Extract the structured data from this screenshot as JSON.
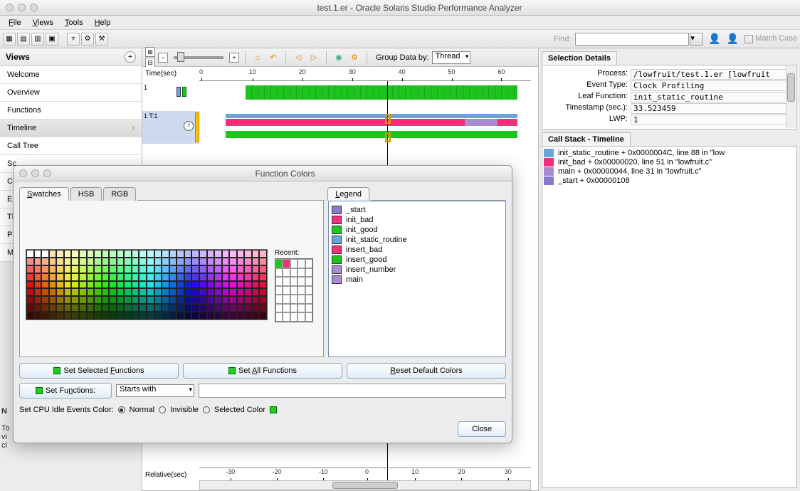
{
  "window": {
    "title": "test.1.er  -  Oracle Solaris Studio Performance Analyzer"
  },
  "menubar": {
    "file": "File",
    "views": "Views",
    "tools": "Tools",
    "help": "Help"
  },
  "toolbar": {
    "find_label": "Find:",
    "match_case": "Match Case"
  },
  "sidebar": {
    "title": "Views",
    "items": [
      {
        "label": "Welcome"
      },
      {
        "label": "Overview"
      },
      {
        "label": "Functions"
      },
      {
        "label": "Timeline",
        "selected": true
      },
      {
        "label": "Call Tree"
      },
      {
        "label": "Sc"
      },
      {
        "label": "Ca"
      },
      {
        "label": "Ex"
      },
      {
        "label": "Th"
      },
      {
        "label": "Pr"
      },
      {
        "label": "M"
      }
    ]
  },
  "timeline_toolbar": {
    "group_by_label": "Group Data by:",
    "group_by_value": "Thread"
  },
  "timeline": {
    "axis_label": "Time(sec)",
    "ticks": [
      "0",
      "10",
      "20",
      "30",
      "40",
      "50",
      "60"
    ],
    "row1_label": "1",
    "row2_label": "1 T:1",
    "bottom_label": "Relative(sec)",
    "bottom_ticks": [
      "-30",
      "-20",
      "-10",
      "0",
      "10",
      "20",
      "30"
    ]
  },
  "selection_details": {
    "title": "Selection Details",
    "process_label": "Process:",
    "process_value": "/lowfruit/test.1.er [lowfruit",
    "event_label": "Event Type:",
    "event_value": "Clock Profiling",
    "leaf_label": "Leaf Function:",
    "leaf_value": "init_static_routine",
    "ts_label": "Timestamp (sec.):",
    "ts_value": "33.523459",
    "lwp_label": "LWP:",
    "lwp_value": "1"
  },
  "callstack": {
    "title": "Call Stack - Timeline",
    "rows": [
      {
        "color": "#6aa5d8",
        "text": "init_static_routine + 0x0000004C, line 88 in \"low"
      },
      {
        "color": "#f03078",
        "text": "init_bad + 0x00000020, line 51 in \"lowfruit.c\""
      },
      {
        "color": "#a88bd0",
        "text": "main + 0x00000044, line 31 in \"lowfruit.c\""
      },
      {
        "color": "#8a78c8",
        "text": "_start + 0x00000108"
      }
    ]
  },
  "dialog": {
    "title": "Function Colors",
    "tab_swatches": "Swatches",
    "tab_hsb": "HSB",
    "tab_rgb": "RGB",
    "recent_label": "Recent:",
    "legend_tab": "Legend",
    "legend": [
      {
        "color": "#8a78c8",
        "label": "_start"
      },
      {
        "color": "#f03078",
        "label": "init_bad"
      },
      {
        "color": "#1ec41e",
        "label": "init_good"
      },
      {
        "color": "#6aa5d8",
        "label": "init_static_routine"
      },
      {
        "color": "#f03078",
        "label": "insert_bad"
      },
      {
        "color": "#1ec41e",
        "label": "insert_good"
      },
      {
        "color": "#a88bd0",
        "label": "insert_number"
      },
      {
        "color": "#a88bd0",
        "label": "main"
      }
    ],
    "btn_set_selected": "Set Selected Functions",
    "btn_set_all": "Set All Functions",
    "btn_reset": "Reset Default Colors",
    "btn_set_functions": "Set Functions:",
    "filter_mode": "Starts with",
    "idle_label": "Set CPU Idle Events Color:",
    "idle_normal": "Normal",
    "idle_invisible": "Invisible",
    "idle_selected": "Selected Color",
    "close": "Close"
  },
  "truncated": {
    "n": "N",
    "to": "To",
    "vi": "vi",
    "cl": "cl"
  },
  "colors": {
    "green": "#1ec41e",
    "blue": "#6aa5d8",
    "magenta": "#f03078",
    "purple": "#a88bd0"
  }
}
